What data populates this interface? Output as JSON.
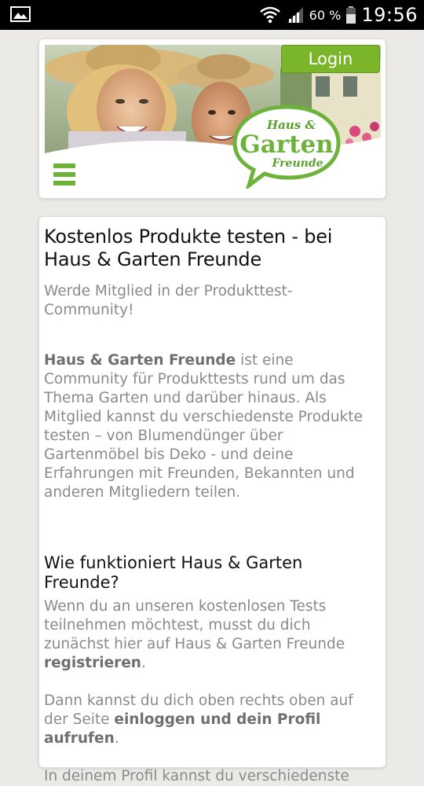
{
  "status_bar": {
    "battery_percent": "60 %",
    "time": "19:56"
  },
  "header": {
    "login_label": "Login",
    "logo": {
      "line1": "Haus &",
      "line2": "Garten",
      "line3": "Freunde"
    }
  },
  "content": {
    "title": "Kostenlos Produkte testen - bei Haus & Garten Freunde",
    "subtitle": "Werde Mitglied in der Produkttest-Community!",
    "intro_bold": "Haus & Garten Freunde",
    "intro_text": " ist eine Community für Produkttests rund um das Thema Garten und darüber hinaus. Als Mitglied kannst du verschiedenste Produkte testen – von Blumendünger über Gartenmöbel bis Deko - und deine Erfahrungen mit Freunden, Bekannten und anderen Mitgliedern teilen.",
    "section_title": "Wie funktioniert Haus & Garten Freunde?",
    "p1_text": "Wenn du an unseren kostenlosen Tests teilnehmen möchtest, musst du dich zunächst hier auf Haus & Garten Freunde ",
    "p1_bold": "registrieren",
    "p1_end": ".",
    "p2_text": "Dann kannst du dich oben rechts oben auf der Seite ",
    "p2_bold": "einloggen und dein Profil aufrufen",
    "p2_end": ".",
    "p3_text": "In deinem Profil kannst du verschiedenste"
  },
  "colors": {
    "brand_green": "#7ab52a",
    "menu_green": "#6cb23b",
    "text_gray": "#8a8a8a"
  }
}
